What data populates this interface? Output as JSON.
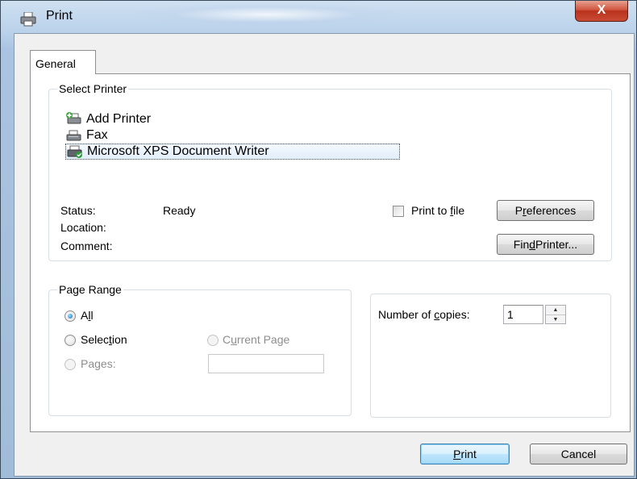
{
  "window": {
    "title": "Print",
    "close_glyph": "X"
  },
  "tabs": [
    {
      "label": "General",
      "active": true
    }
  ],
  "select_printer": {
    "legend": "Select Printer",
    "printers": [
      {
        "name": "Add Printer",
        "icon": "add-printer-icon",
        "selected": false
      },
      {
        "name": "Fax",
        "icon": "fax-icon",
        "selected": false
      },
      {
        "name": "Microsoft XPS Document Writer",
        "icon": "xps-printer-icon",
        "selected": true
      }
    ],
    "status_label": "Status:",
    "status_value": "Ready",
    "location_label": "Location:",
    "location_value": "",
    "comment_label": "Comment:",
    "comment_value": "",
    "print_to_file": {
      "pre": "Print to ",
      "hotkey": "f",
      "post": "ile",
      "checked": false
    },
    "preferences": {
      "pre": "P",
      "hotkey": "r",
      "post": "eferences"
    },
    "find_printer": {
      "pre": "Fin",
      "hotkey": "d",
      "post": " Printer..."
    }
  },
  "page_range": {
    "legend": "Page Range",
    "all": {
      "pre": "A",
      "hotkey": "l",
      "post": "l",
      "checked": true
    },
    "selection": {
      "pre": "Selec",
      "hotkey": "t",
      "post": "ion",
      "checked": false
    },
    "current_page": {
      "pre": "C",
      "hotkey": "u",
      "post": "rrent Page",
      "checked": false,
      "disabled": true
    },
    "pages": {
      "pre": "Pa",
      "hotkey": "g",
      "post": "es:",
      "checked": false,
      "disabled": true
    },
    "pages_value": ""
  },
  "copies": {
    "label_pre": "Number of ",
    "label_hotkey": "c",
    "label_post": "opies:",
    "value": "1"
  },
  "buttons": {
    "print": {
      "pre": "",
      "hotkey": "P",
      "post": "rint"
    },
    "cancel": "Cancel"
  },
  "colors": {
    "accent": "#3c7fb1",
    "close_button": "#c94a34",
    "selection_border": "#444444"
  }
}
